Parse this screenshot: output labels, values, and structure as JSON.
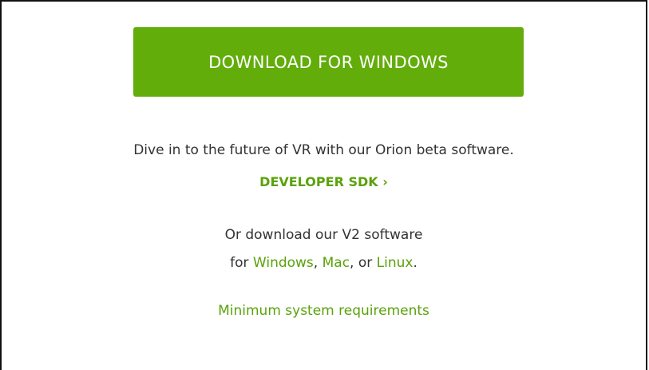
{
  "colors": {
    "accent_green": "#62ad0a",
    "link_green": "#5aa20a",
    "body_text": "#333333",
    "frame_border": "#111111"
  },
  "download_button": {
    "label": "DOWNLOAD FOR WINDOWS"
  },
  "tagline": "Dive in to the future of VR with our Orion beta software.",
  "developer_sdk": {
    "label": "DEVELOPER SDK ›"
  },
  "v2": {
    "line1": "Or download our V2 software",
    "prefix": "for ",
    "windows_link": "Windows",
    "sep1": ", ",
    "mac_link": "Mac",
    "sep2": ", or ",
    "linux_link": "Linux",
    "suffix": "."
  },
  "requirements_link": "Minimum system requirements"
}
